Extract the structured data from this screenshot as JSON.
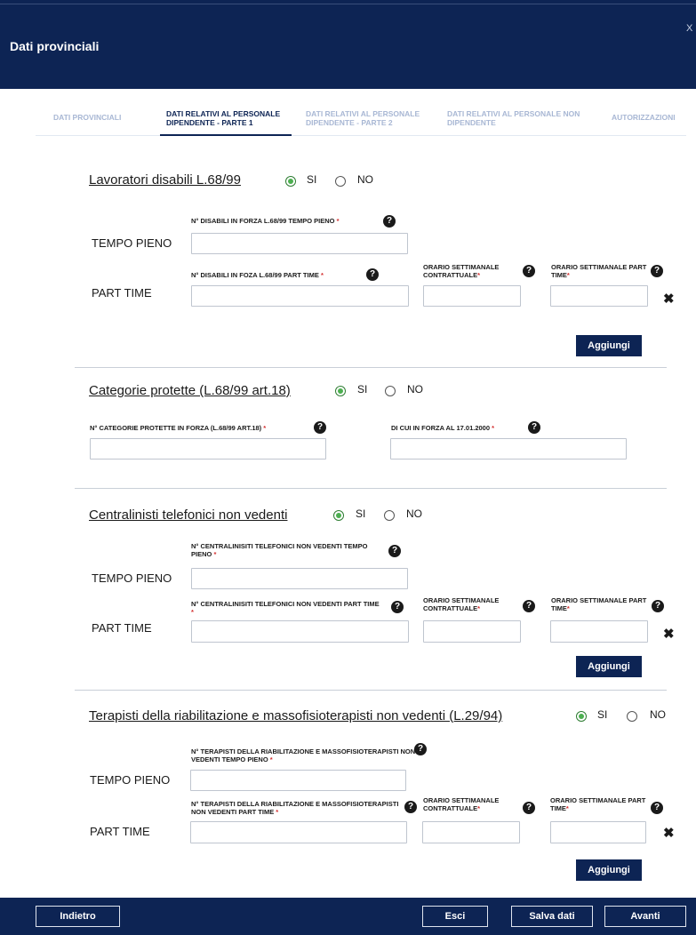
{
  "header": {
    "title": "Dati provinciali",
    "close": "X"
  },
  "tabs": [
    "DATI PROVINCIALI",
    "DATI RELATIVI AL PERSONALE DIPENDENTE - PARTE 1",
    "DATI RELATIVI AL PERSONALE DIPENDENTE - PARTE 2",
    "DATI RELATIVI AL PERSONALE NON DIPENDENTE",
    "AUTORIZZAZIONI"
  ],
  "radio": {
    "yes": "SI",
    "no": "NO"
  },
  "common": {
    "tempo_pieno": "TEMPO PIENO",
    "part_time": "PART TIME",
    "orario_contrattuale": "ORARIO SETTIMANALE CONTRATTUALE",
    "orario_part_time": "ORARIO SETTIMANALE PART TIME",
    "add": "Aggiungi",
    "required": "*",
    "help": "?",
    "remove": "✖"
  },
  "sections": [
    {
      "title": "Lavoratori disabili L.68/99",
      "selected": "SI",
      "fields": {
        "full_time": "N° DISABILI IN FORZA L.68/99 TEMPO PIENO",
        "part_time": "N° DISABILI IN FOZA L.68/99 PART TIME"
      }
    },
    {
      "title": "Categorie protette (L.68/99 art.18)",
      "selected": "SI",
      "fields": {
        "count": "N° CATEGORIE PROTETTE IN FORZA (L.68/99 art.18)",
        "since": "DI CUI IN FORZA AL 17.01.2000"
      }
    },
    {
      "title": "Centralinisti telefonici non vedenti",
      "selected": "SI",
      "fields": {
        "full_time": "N° CENTRALINISITI TELEFONICI NON VEDENTI TEMPO PIENO",
        "part_time": "N° CENTRALINISITI TELEFONICI NON VEDENTI PART TIME"
      }
    },
    {
      "title": "Terapisti della riabilitazione e massofisioterapisti non vedenti (L.29/94)",
      "selected": "SI",
      "fields": {
        "full_time": "N° TERAPISTI DELLA RIABILITAZIONE E MASSOFISIOTERAPISTI NON VEDENTI TEMPO PIENO",
        "part_time": "N° TERAPISTI DELLA RIABILITAZIONE E MASSOFISIOTERAPISTI NON VEDENTI PART TIME"
      }
    }
  ],
  "footer": {
    "back": "Indietro",
    "exit": "Esci",
    "save": "Salva dati",
    "next": "Avanti"
  }
}
